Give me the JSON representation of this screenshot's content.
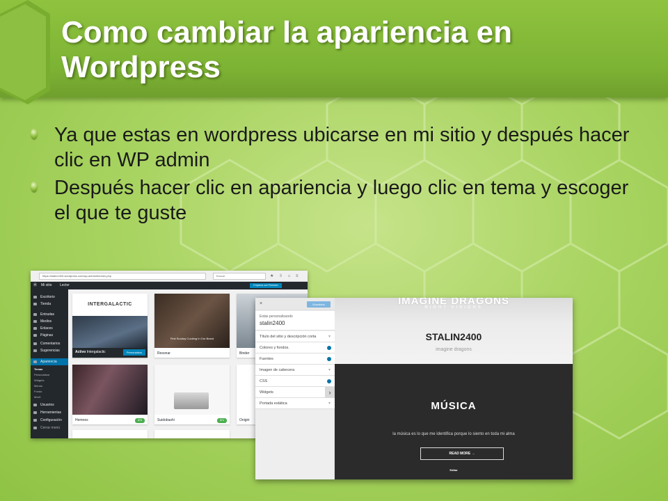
{
  "slide": {
    "title": "Como cambiar la apariencia en Wordpress",
    "bullets": [
      "Ya que estas en wordpress ubicarse en mi sitio y después hacer clic en WP admin",
      "Después hacer clic en apariencia y luego clic en tema y escoger el que te guste"
    ],
    "colors": {
      "title_band": "#7db334",
      "background": "#a9d462",
      "title_text": "#ffffff"
    }
  },
  "wp_admin": {
    "url": "https://stalin2400.wordpress.com/wp-admin/themes.php",
    "search_placeholder": "Buscar",
    "adminbar": {
      "site": "Mi sitio",
      "reader": "Lector",
      "premium": "Empieza con Premium"
    },
    "menu": [
      {
        "label": "Escritorio"
      },
      {
        "label": "Tienda"
      },
      {
        "label": "Entradas"
      },
      {
        "label": "Medios"
      },
      {
        "label": "Enlaces"
      },
      {
        "label": "Páginas"
      },
      {
        "label": "Comentarios"
      },
      {
        "label": "Sugerencias"
      },
      {
        "label": "Apariencia"
      },
      {
        "label": "Usuarios"
      },
      {
        "label": "Herramientas"
      },
      {
        "label": "Configuración"
      },
      {
        "label": "Cerrar menú"
      }
    ],
    "submenu": [
      "Temas",
      "Personalizar",
      "Widgets",
      "Menús",
      "Fondo",
      "Móvil"
    ],
    "themes": [
      {
        "name": "Intergalactic",
        "active_label": "Activo",
        "button": "Personalizar",
        "title": "INTERGALACTIC"
      },
      {
        "name": "Resonar",
        "caption": "First Sunday Cooking In Our Brand"
      },
      {
        "name": "Binder"
      },
      {
        "name": "Hemnes",
        "price": "$78"
      },
      {
        "name": "Suidobashi",
        "price": "$74"
      },
      {
        "name": "Onigiri"
      }
    ]
  },
  "customizer": {
    "close": "×",
    "save": "Guardado",
    "site_label": "Estás personalizando",
    "site_name": "stalin2400",
    "sections": [
      {
        "label": "Título del sitio y descripción corta",
        "mark": "chev"
      },
      {
        "label": "Colores y fondos.",
        "mark": "dot"
      },
      {
        "label": "Fuentes",
        "mark": "dot"
      },
      {
        "label": "Imagen de cabecera",
        "mark": "chev"
      },
      {
        "label": "CSS",
        "mark": "dot"
      },
      {
        "label": "Widgets",
        "mark": "active"
      },
      {
        "label": "Portada estática",
        "mark": "chev"
      }
    ],
    "preview": {
      "brand": "IMAGINE DRAGONS",
      "brand_sub": "NIGHT VISIONS",
      "site_title": "STALIN2400",
      "tagline": "imagine dragons",
      "section_title": "MÚSICA",
      "section_text": "la música es lo que me identifica porque lo siento en toda mi alma",
      "button": "READ MORE →",
      "edit": "Editar"
    }
  }
}
